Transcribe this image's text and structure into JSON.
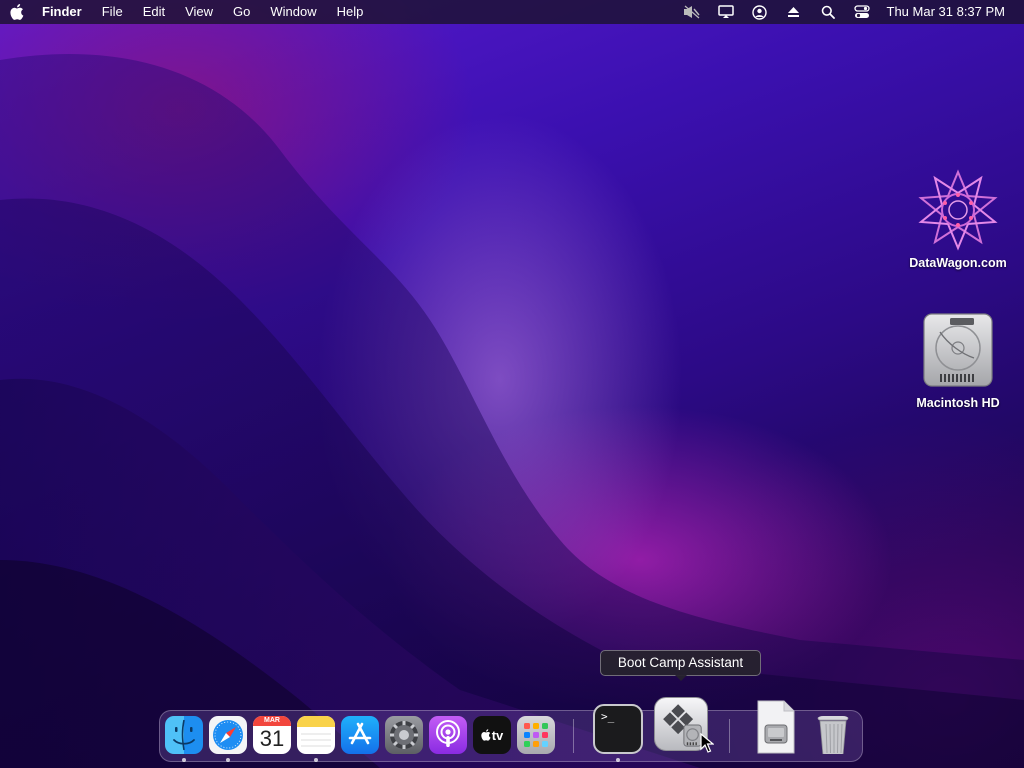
{
  "menubar": {
    "app_name": "Finder",
    "items": [
      "File",
      "Edit",
      "View",
      "Go",
      "Window",
      "Help"
    ],
    "clock": "Thu Mar 31  8:37 PM",
    "status_icons": [
      "mute-icon",
      "display-icon",
      "user-icon",
      "eject-icon",
      "search-icon",
      "control-center-icon"
    ]
  },
  "desktop": {
    "icons": [
      {
        "label": "DataWagon.com",
        "icon": "datawagon-star-icon"
      },
      {
        "label": "Macintosh HD",
        "icon": "hard-drive-icon"
      }
    ]
  },
  "dock": {
    "apps": [
      {
        "name": "Finder",
        "icon": "finder-icon",
        "running": true
      },
      {
        "name": "Safari",
        "icon": "safari-icon",
        "running": true
      },
      {
        "name": "Calendar",
        "icon": "calendar-icon",
        "running": false,
        "month": "MAR",
        "day": "31"
      },
      {
        "name": "Notes",
        "icon": "notes-icon",
        "running": true
      },
      {
        "name": "App Store",
        "icon": "app-store-icon",
        "running": false
      },
      {
        "name": "System Preferences",
        "icon": "settings-gear-icon",
        "running": false
      },
      {
        "name": "Podcasts",
        "icon": "podcasts-icon",
        "running": false
      },
      {
        "name": "TV",
        "icon": "apple-tv-icon",
        "running": false,
        "glyph": "tv"
      },
      {
        "name": "Launchpad",
        "icon": "launchpad-icon",
        "running": false
      },
      {
        "name": "Terminal",
        "icon": "terminal-icon",
        "running": true,
        "prompt": ">_"
      },
      {
        "name": "Boot Camp Assistant",
        "icon": "boot-camp-icon",
        "running": false
      },
      {
        "name": "Downloads",
        "icon": "downloads-icon",
        "running": false
      },
      {
        "name": "Trash",
        "icon": "trash-icon",
        "running": false
      }
    ],
    "tooltip": "Boot Camp Assistant"
  },
  "colors": {
    "menubar_bg": "#1c1230",
    "wallpaper_primary": "#3b10b0",
    "wallpaper_accent": "#cd28c8"
  }
}
